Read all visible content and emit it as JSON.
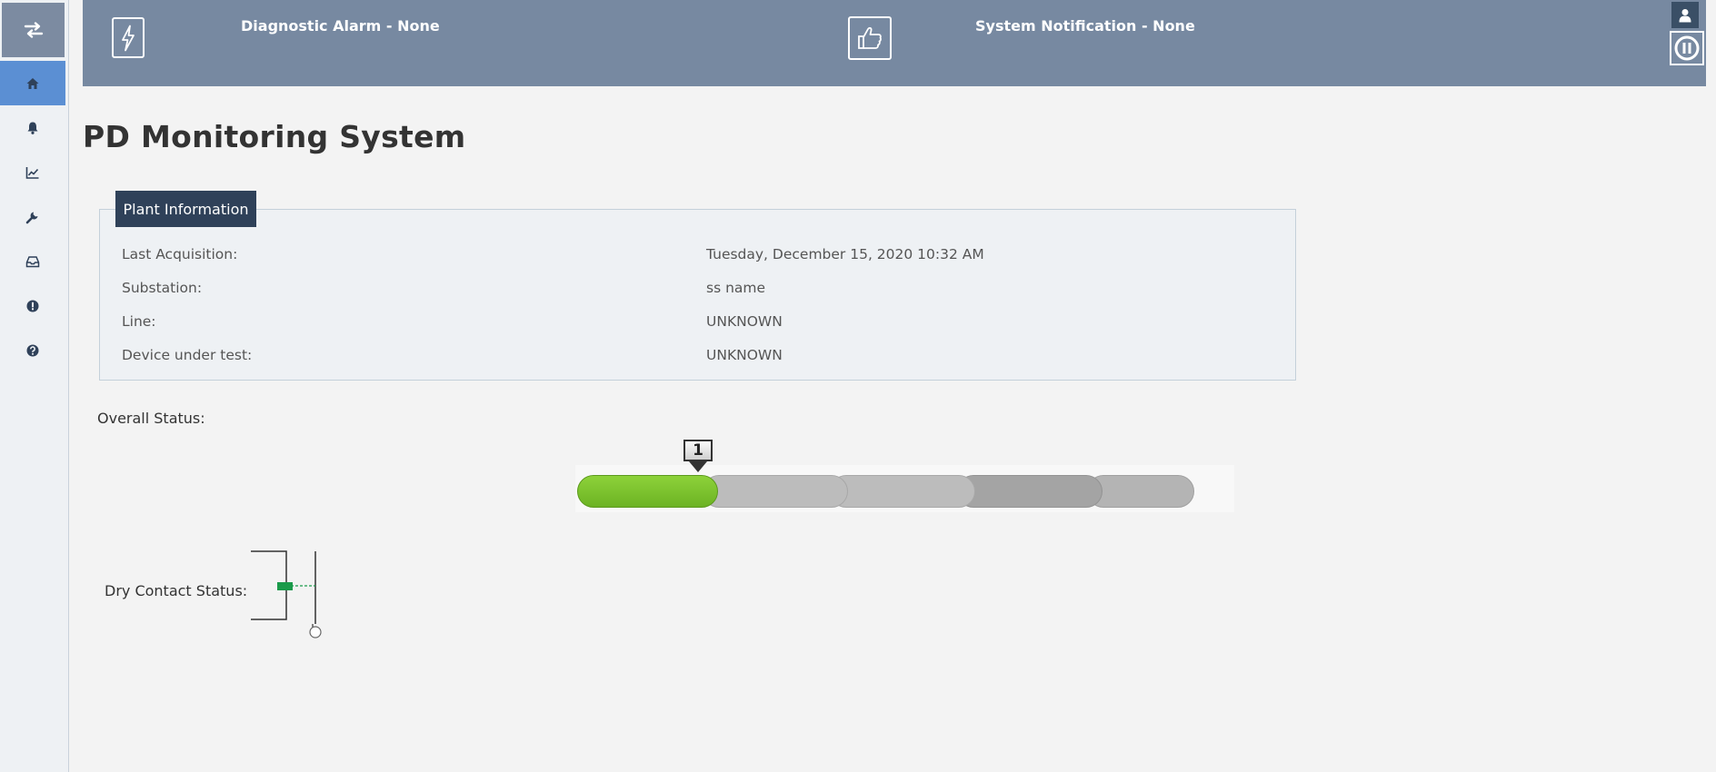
{
  "header": {
    "diagnostic_alarm": "Diagnostic Alarm - None",
    "system_notification": "System Notification - None"
  },
  "page": {
    "title": "PD Monitoring System"
  },
  "plant_info": {
    "tab_label": "Plant Information",
    "rows": [
      {
        "label": "Last Acquisition:",
        "value": "Tuesday, December 15, 2020 10:32 AM"
      },
      {
        "label": "Substation:",
        "value": "ss name"
      },
      {
        "label": "Line:",
        "value": "UNKNOWN"
      },
      {
        "label": "Device under test:",
        "value": "UNKNOWN"
      }
    ]
  },
  "overall_status": {
    "label": "Overall Status:",
    "level": "1",
    "level_index": 1,
    "level_count": 5
  },
  "dry_contact": {
    "label": "Dry Contact Status:"
  },
  "sidebar": {
    "items": [
      {
        "name": "home",
        "icon": "home-icon"
      },
      {
        "name": "alarms",
        "icon": "bell-icon"
      },
      {
        "name": "trends",
        "icon": "line-chart-icon"
      },
      {
        "name": "settings",
        "icon": "wrench-icon"
      },
      {
        "name": "storage",
        "icon": "inbox-icon"
      },
      {
        "name": "alerts",
        "icon": "exclamation-circle-icon"
      },
      {
        "name": "help",
        "icon": "question-circle-icon"
      }
    ]
  },
  "colors": {
    "header_bg": "#7789a1",
    "active_nav": "#5b8fd3",
    "panel_tab": "#2f4159",
    "status_active": "#7dc12c",
    "status_inactive": "#b9b9b9",
    "contact_green": "#1a9a4a"
  }
}
